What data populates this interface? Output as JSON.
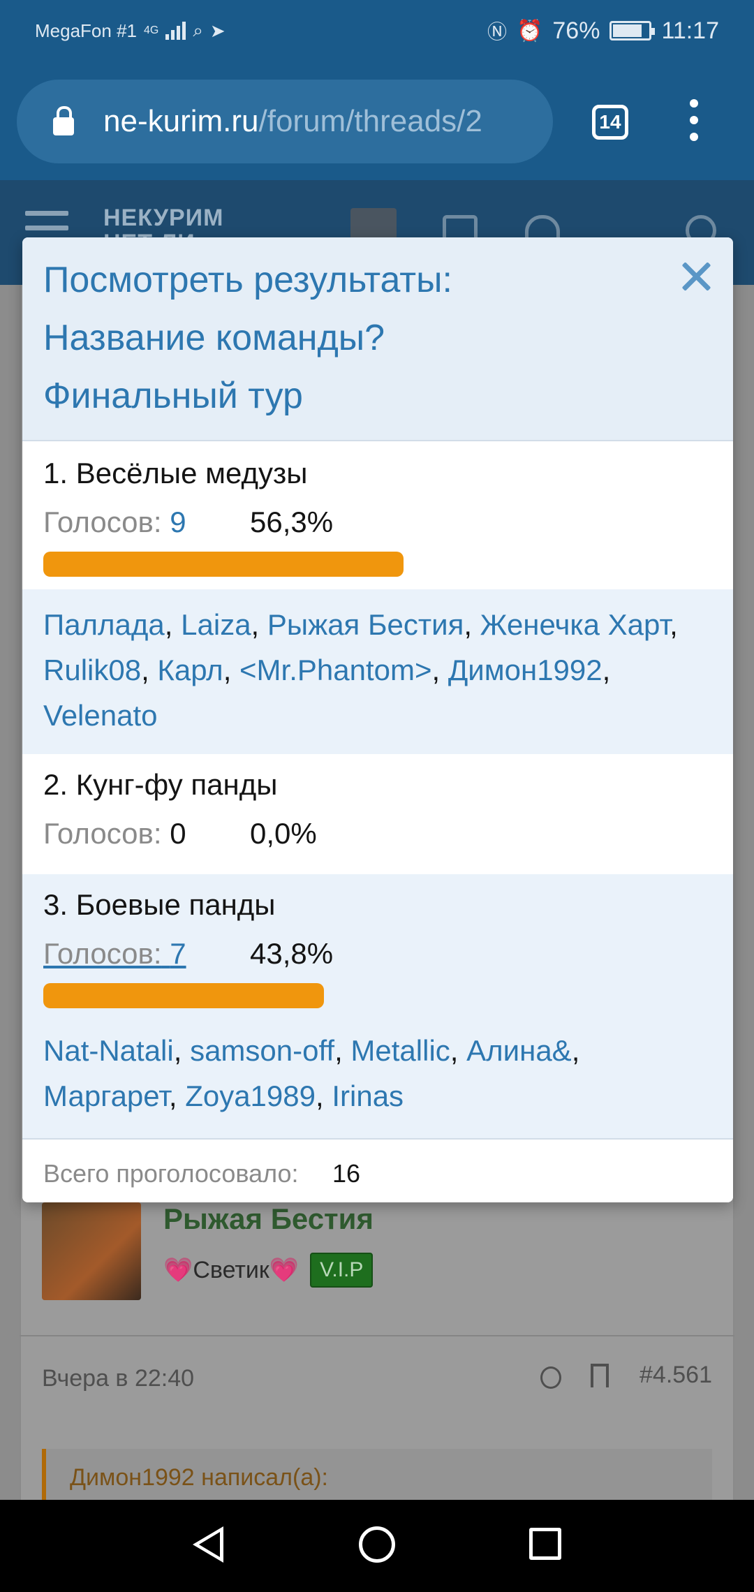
{
  "status_bar": {
    "carrier": "MegaFon #1",
    "network": "4G",
    "battery": "76%",
    "time": "11:17",
    "icons": [
      "signal-icon",
      "search-icon",
      "telegram-icon",
      "nfc-icon",
      "alarm-icon",
      "battery-icon"
    ]
  },
  "browser": {
    "url_host": "ne-kurim.ru",
    "url_path": "/forum/threads/2",
    "tab_count": "14"
  },
  "site": {
    "logo_line1": "НЕКУРИМ",
    "logo_line2": "НЕТ ЛИ"
  },
  "poll_modal": {
    "title_line1": "Посмотреть результаты:",
    "title_line2": "Название команды?",
    "title_line3": "Финальный тур",
    "votes_label": "Голосов:",
    "options": [
      {
        "label": "1. Весёлые медузы",
        "votes": "9",
        "percent": "56,3%",
        "fraction": 0.563,
        "voters": [
          "Паллада",
          "Laiza",
          "Рыжая Бестия",
          "Женечка Харт",
          "Rulik08",
          "Карл",
          "<Mr.Phantom>",
          "Димон1992",
          "Velenato"
        ]
      },
      {
        "label": "2. Кунг-фу панды",
        "votes": "0",
        "percent": "0,0%",
        "fraction": 0.0,
        "voters": []
      },
      {
        "label": "3. Боевые панды",
        "votes": "7",
        "percent": "43,8%",
        "fraction": 0.438,
        "voters": [
          "Nat-Natali",
          "samson-off",
          "Metallic",
          "Алина&",
          "Маргарет",
          "Zoya1989",
          "Irinas"
        ]
      }
    ],
    "total_label": "Всего проголосовало:",
    "total_value": "16"
  },
  "post": {
    "author": "Рыжая Бестия",
    "user_title": "💗Светик💗",
    "badge": "V.I.P",
    "date": "Вчера в 22:40",
    "post_number": "#4.561",
    "quote_header": "Димон1992 написал(а):"
  },
  "colors": {
    "accent": "#2d77b0",
    "bar": "#f0960d",
    "header_bg": "#1a5a8a"
  }
}
